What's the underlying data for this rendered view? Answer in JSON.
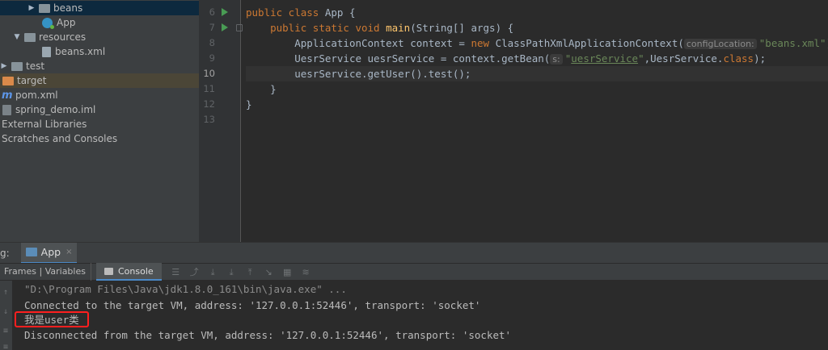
{
  "project_tree": {
    "items": [
      {
        "label": "beans"
      },
      {
        "label": "App"
      },
      {
        "label": "resources"
      },
      {
        "label": "beans.xml"
      },
      {
        "label": "test"
      },
      {
        "label": "target"
      },
      {
        "label": "pom.xml"
      },
      {
        "label": "spring_demo.iml"
      },
      {
        "label": "External Libraries"
      },
      {
        "label": "Scratches and Consoles"
      }
    ]
  },
  "editor": {
    "line_numbers": [
      "6",
      "7",
      "8",
      "9",
      "10",
      "11",
      "12",
      "13"
    ],
    "code": {
      "l6": {
        "kw": "public class",
        "rest": " App {"
      },
      "l7": {
        "kw": "public static void",
        "fn": "main",
        "rest": "(String[] args) {"
      },
      "l8": {
        "pre": "ApplicationContext context = ",
        "kw": "new",
        "mid": " ClassPathXmlApplicationContext(",
        "hint": "configLocation:",
        "str": "\"beans.xml\"",
        "post": ");"
      },
      "l9": {
        "pre": "UesrService uesrService = context.getBean(",
        "hint": "s:",
        "str_a": "\"",
        "str_u": "uesrService",
        "str_b": "\"",
        "mid": ",UesrService.",
        "kw": "class",
        "post": ");"
      },
      "l10": {
        "text": "uesrService.getUser().test();"
      },
      "l11": {
        "text": "}"
      },
      "l12": {
        "text": "}"
      }
    }
  },
  "debug": {
    "label": "g:",
    "tab_label": "App",
    "close_glyph": "×",
    "frames_label": "Frames | Variables",
    "console_label": "Console"
  },
  "console": {
    "lines": [
      "\"D:\\Program Files\\Java\\jdk1.8.0_161\\bin\\java.exe\" ...",
      "Connected to the target VM, address: '127.0.0.1:52446', transport: 'socket'",
      "我是user类",
      "Disconnected from the target VM, address: '127.0.0.1:52446', transport: 'socket'"
    ]
  },
  "colors": {
    "keyword": "#cc7832",
    "function": "#ffc66d",
    "string": "#6a8759",
    "highlight_box": "#ff1f1f"
  }
}
